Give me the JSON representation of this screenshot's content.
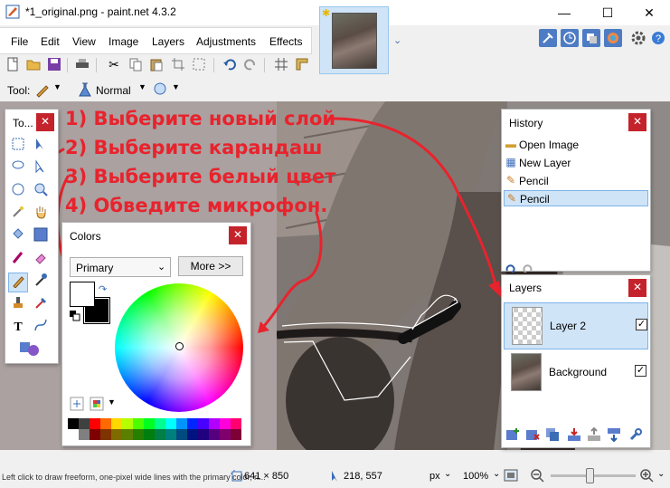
{
  "window": {
    "title": "*1_original.png - paint.net 4.3.2",
    "minimize": "—",
    "maximize": "☐",
    "close": "✕"
  },
  "menu": {
    "items": [
      "File",
      "Edit",
      "View",
      "Image",
      "Layers",
      "Adjustments",
      "Effects"
    ]
  },
  "tool_options": {
    "tool_label": "Tool:",
    "blend_mode": "Normal"
  },
  "tools_window": {
    "title": "To..."
  },
  "colors_window": {
    "title": "Colors",
    "mode_select": "Primary",
    "more_button": "More >>",
    "primary_color": "#ffffff",
    "secondary_color": "#000000"
  },
  "history_window": {
    "title": "History",
    "items": [
      "Open Image",
      "New Layer",
      "Pencil",
      "Pencil"
    ]
  },
  "layers_window": {
    "title": "Layers",
    "layers": [
      {
        "name": "Layer 2",
        "visible": "✓"
      },
      {
        "name": "Background",
        "visible": "✓"
      }
    ]
  },
  "annotations": {
    "lines": [
      "1) Выберите новый слой",
      "2) Выберите карандаш",
      "3) Выберите белый цвет",
      "4) Обведите микрофон."
    ],
    "color": "#e8232d"
  },
  "status": {
    "hint": "Left click to draw freeform, one-pixel wide lines with the primary color, ri...",
    "image_size": "641 × 850",
    "cursor_pos": "218, 557",
    "units": "px",
    "zoom": "100%"
  },
  "palette": [
    "#000000",
    "#404040",
    "#ff0000",
    "#ff6a00",
    "#ffd800",
    "#b6ff00",
    "#4cff00",
    "#00ff21",
    "#00ff90",
    "#00ffff",
    "#0094ff",
    "#0026ff",
    "#4800ff",
    "#b200ff",
    "#ff00dc",
    "#ff006e",
    "#ffffff",
    "#808080",
    "#7f0000",
    "#7f3300",
    "#7f6a00",
    "#5b7f00",
    "#267f00",
    "#007f0e",
    "#007f46",
    "#007f7f",
    "#004a7f",
    "#00137f",
    "#21007f",
    "#57007f",
    "#7f006e",
    "#7f0037"
  ]
}
